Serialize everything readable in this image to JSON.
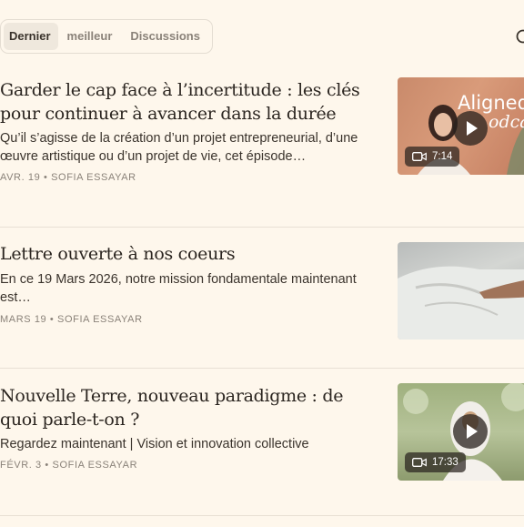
{
  "tabs": [
    {
      "label": "Dernier",
      "active": true
    },
    {
      "label": "meilleur",
      "active": false
    },
    {
      "label": "Discussions",
      "active": false
    }
  ],
  "posts": [
    {
      "title": "Garder le cap face à l’incertitude : les clés pour continuer à avancer dans la durée",
      "subtitle": "Qu’il s’agisse de la création d’un projet entrepreneurial, d’une œuvre artistique ou d’un projet de vie, cet épisode…",
      "meta": "AVR. 19 • SOFIA ESSAYAR",
      "thumb_text": "Aligned",
      "thumb_text2": "odcas",
      "duration": "7:14"
    },
    {
      "title": "Lettre ouverte à nos coeurs",
      "subtitle": "En ce 19 Mars 2026, notre mission fondamentale maintenant est…",
      "meta": "MARS 19 • SOFIA ESSAYAR"
    },
    {
      "title": "Nouvelle Terre, nouveau paradigme : de quoi parle-t-on ?",
      "subtitle": "Regardez maintenant | Vision et innovation collective",
      "meta": "FÉVR. 3 • SOFIA ESSAYAR",
      "duration": "17:33"
    }
  ],
  "icons": {
    "search": "search-icon",
    "play": "play-icon",
    "video": "video-camera-icon"
  }
}
